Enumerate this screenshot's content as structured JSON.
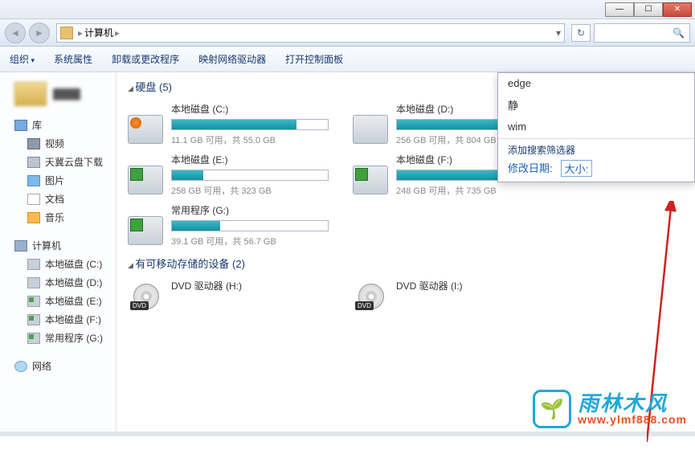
{
  "breadcrumb": {
    "root": "计算机",
    "sep": "▸"
  },
  "toolbar": {
    "organize": "组织",
    "sysprops": "系统属性",
    "uninstall": "卸载或更改程序",
    "mapdrive": "映射网络驱动器",
    "ctrlpanel": "打开控制面板"
  },
  "sidebar": {
    "libs_label": "库",
    "libs": [
      {
        "label": "视频",
        "icon": "vid"
      },
      {
        "label": "天冀云盘下载",
        "icon": "dl"
      },
      {
        "label": "图片",
        "icon": "pic"
      },
      {
        "label": "文档",
        "icon": "doc"
      },
      {
        "label": "音乐",
        "icon": "mus"
      }
    ],
    "computer_label": "计算机",
    "drives": [
      {
        "label": "本地磁盘 (C:)",
        "icon": "disk"
      },
      {
        "label": "本地磁盘 (D:)",
        "icon": "disk"
      },
      {
        "label": "本地磁盘 (E:)",
        "icon": "diskg"
      },
      {
        "label": "本地磁盘 (F:)",
        "icon": "diskg"
      },
      {
        "label": "常用程序 (G:)",
        "icon": "diskg"
      }
    ],
    "network_label": "网络"
  },
  "sections": {
    "hdd": "硬盘 (5)",
    "removable": "有可移动存储的设备 (2)"
  },
  "drives": [
    {
      "name": "本地磁盘 (C:)",
      "text": "11.1 GB 可用，共 55.0 GB",
      "fill": 80,
      "icon": "sys"
    },
    {
      "name": "本地磁盘 (D:)",
      "text": "256 GB 可用，共 804 GB",
      "fill": 68,
      "icon": ""
    },
    {
      "name": "本地磁盘 (E:)",
      "text": "258 GB 可用，共 323 GB",
      "fill": 20,
      "icon": "g"
    },
    {
      "name": "本地磁盘 (F:)",
      "text": "248 GB 可用，共 735 GB",
      "fill": 66,
      "icon": "g"
    },
    {
      "name": "常用程序 (G:)",
      "text": "39.1 GB 可用，共 56.7 GB",
      "fill": 31,
      "icon": "g"
    }
  ],
  "dvds": [
    {
      "name": "DVD 驱动器 (H:)"
    },
    {
      "name": "DVD 驱动器 (I:)"
    }
  ],
  "searchdrop": {
    "history": [
      "edge",
      "静",
      "wim"
    ],
    "filter_title": "添加搜索筛选器",
    "filter_date": "修改日期:",
    "filter_size": "大小:"
  },
  "watermark": {
    "name": "雨林木风",
    "url": "www.ylmf888.com"
  }
}
